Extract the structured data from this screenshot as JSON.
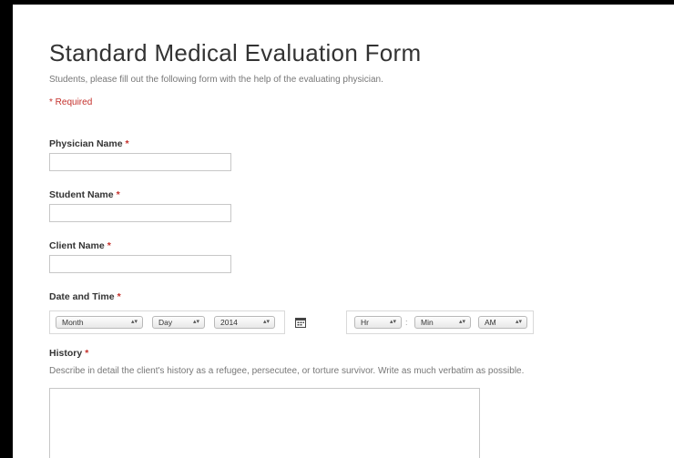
{
  "form": {
    "title": "Standard Medical Evaluation Form",
    "description": "Students, please fill out the following form with the help of the evaluating physician.",
    "required_note": "* Required"
  },
  "fields": {
    "physician": {
      "label": "Physician Name",
      "required_mark": "*",
      "value": ""
    },
    "student": {
      "label": "Student Name",
      "required_mark": "*",
      "value": ""
    },
    "client": {
      "label": "Client Name",
      "required_mark": "*",
      "value": ""
    },
    "datetime": {
      "label": "Date and Time",
      "required_mark": "*",
      "month": "Month",
      "day": "Day",
      "year": "2014",
      "hour": "Hr",
      "separator": ":",
      "minute": "Min",
      "ampm": "AM"
    },
    "history": {
      "label": "History",
      "required_mark": "*",
      "help": "Describe in detail the client's history as a refugee, persecutee, or torture survivor. Write as much verbatim as possible.",
      "value": ""
    }
  },
  "icons": {
    "dropdown_arrow": "updown-arrow-icon",
    "calendar": "calendar-icon"
  }
}
